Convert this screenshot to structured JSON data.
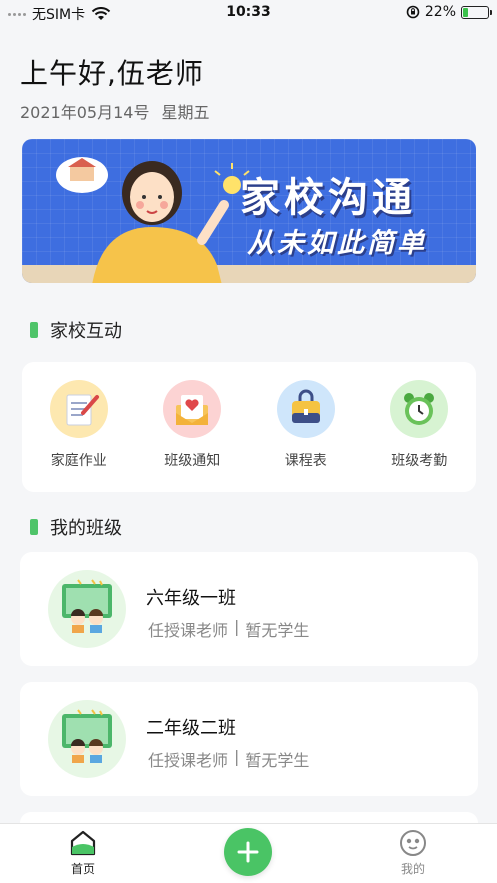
{
  "status_bar": {
    "carrier": "无SIM卡",
    "time": "10:33",
    "battery_percent": "22%",
    "battery_level": 0.22
  },
  "header": {
    "greeting": "上午好,伍老师",
    "date": "2021年05月14号",
    "weekday": "星期五"
  },
  "banner": {
    "title": "家校沟通",
    "subtitle": "从未如此简单"
  },
  "sections": {
    "interaction_title": "家校互动",
    "my_class_title": "我的班级"
  },
  "interactions": [
    {
      "label": "家庭作业",
      "icon": "homework-icon"
    },
    {
      "label": "班级通知",
      "icon": "notice-icon"
    },
    {
      "label": "课程表",
      "icon": "timetable-icon"
    },
    {
      "label": "班级考勤",
      "icon": "attendance-clock-icon"
    }
  ],
  "classes": [
    {
      "name": "六年级一班",
      "role": "任授课老师",
      "separator": "|",
      "students": "暂无学生"
    },
    {
      "name": "二年级二班",
      "role": "任授课老师",
      "separator": "|",
      "students": "暂无学生"
    }
  ],
  "tab_bar": {
    "home_label": "首页",
    "mine_label": "我的"
  },
  "colors": {
    "accent": "#4ac465",
    "banner_blue": "#3e6ee0"
  }
}
